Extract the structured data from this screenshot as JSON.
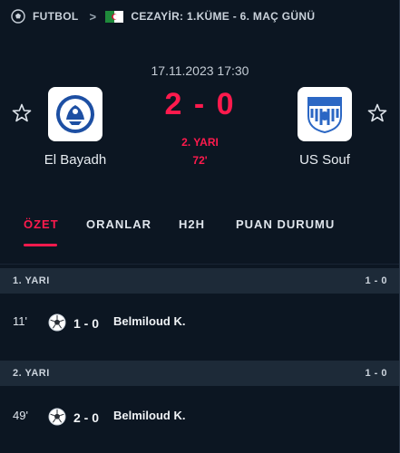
{
  "breadcrumb": {
    "sport_icon": "soccer-ball-icon",
    "sport": "FUTBOL",
    "separator": ">",
    "country_flag": "algeria-flag",
    "league": "CEZAYİR: 1.KÜME - 6. MAÇ GÜNÜ"
  },
  "match": {
    "datetime": "17.11.2023 17:30",
    "home": {
      "name": "El Bayadh",
      "logo_icon": "el-bayadh-crest-icon"
    },
    "away": {
      "name": "US Souf",
      "logo_icon": "us-souf-crest-icon"
    },
    "score": "2 - 0",
    "period": "2. YARI",
    "minute": "72'",
    "accent_color": "#ff1a4d"
  },
  "tabs": [
    {
      "label": "ÖZET",
      "active": true
    },
    {
      "label": "ORANLAR",
      "active": false
    },
    {
      "label": "H2H",
      "active": false
    },
    {
      "label": "PUAN DURUMU",
      "active": false
    }
  ],
  "summary": {
    "halves": [
      {
        "label": "1. YARI",
        "score": "1 - 0",
        "events": [
          {
            "minute": "11'",
            "icon": "soccer-ball-icon",
            "score": "1 - 0",
            "player": "Belmiloud K."
          }
        ]
      },
      {
        "label": "2. YARI",
        "score": "1 - 0",
        "events": [
          {
            "minute": "49'",
            "icon": "soccer-ball-icon",
            "score": "2 - 0",
            "player": "Belmiloud K."
          }
        ]
      }
    ]
  }
}
